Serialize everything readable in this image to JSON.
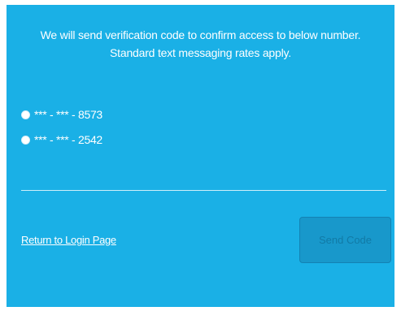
{
  "colors": {
    "panel_background": "#1ab0e6",
    "button_background": "#1898cb",
    "button_text": "#117aa6",
    "text": "#ffffff"
  },
  "message": {
    "line1": "We will send verification code to confirm access to below number.",
    "line2": "Standard text messaging rates apply."
  },
  "phone_options": [
    {
      "label": "*** - *** - 8573",
      "selected": false
    },
    {
      "label": "*** - *** - 2542",
      "selected": false
    }
  ],
  "footer": {
    "return_link": "Return to Login Page",
    "send_button": "Send Code"
  }
}
